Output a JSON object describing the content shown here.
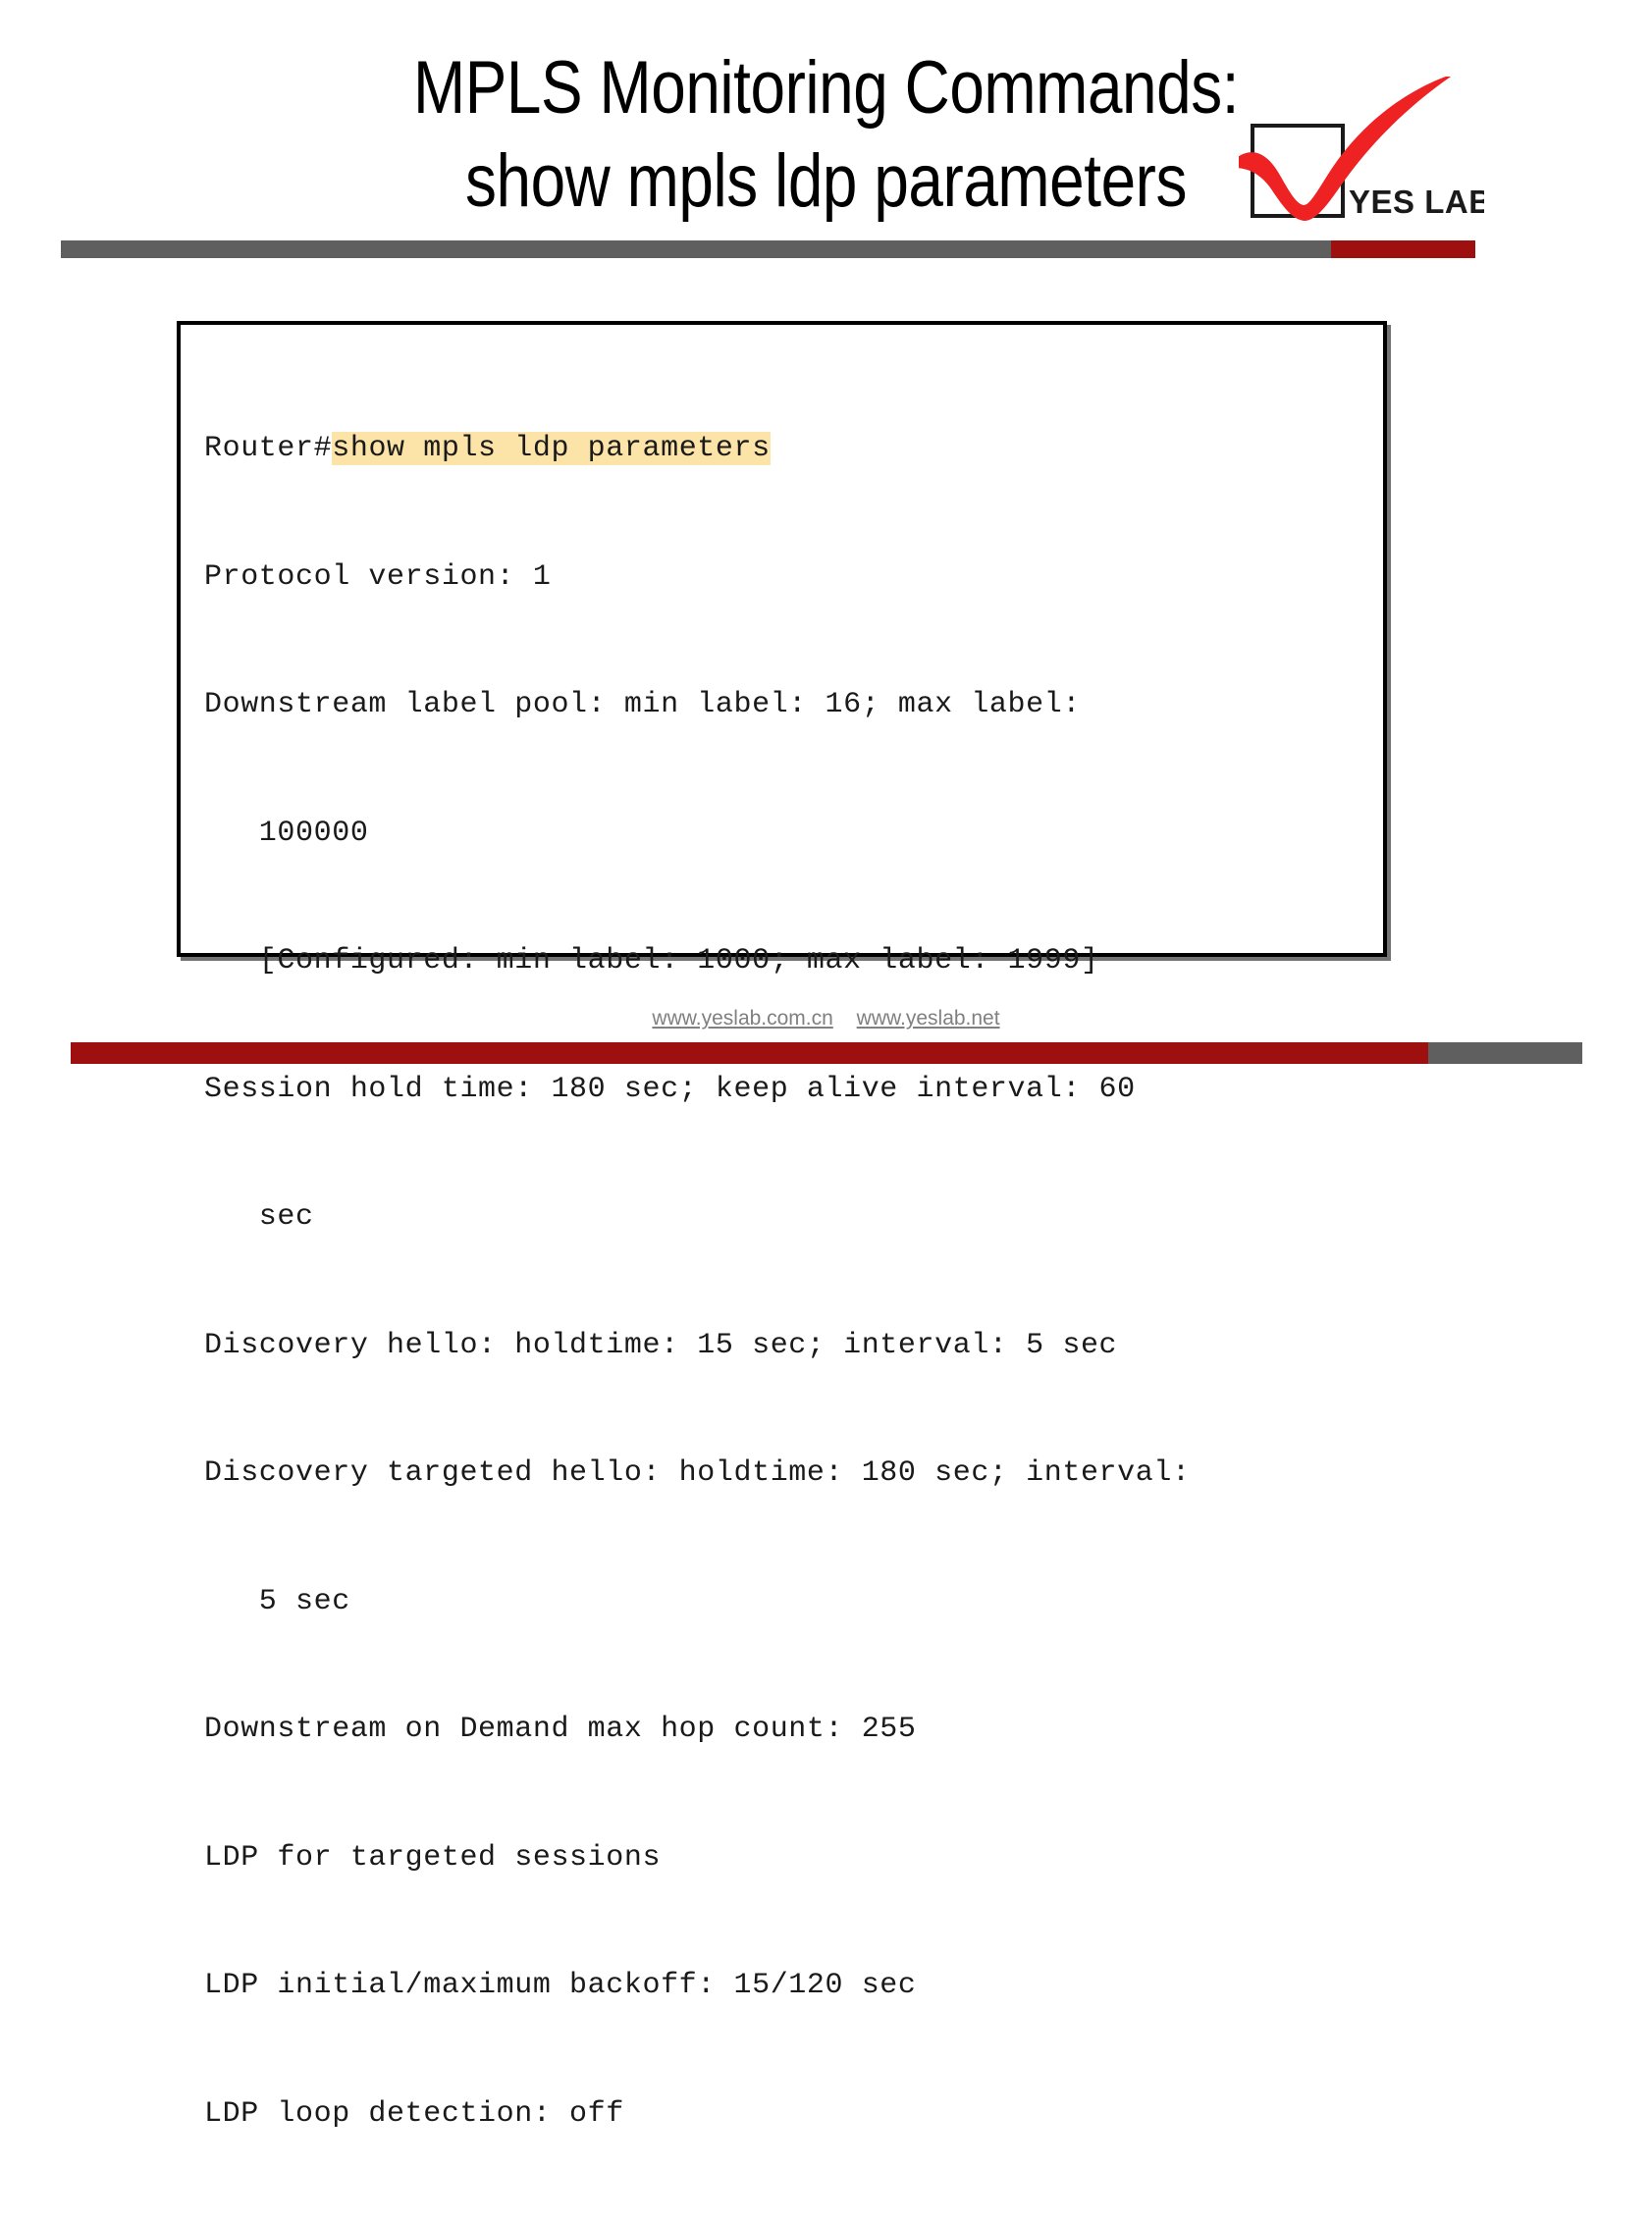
{
  "slide": {
    "title_lines": [
      "MPLS Monitoring Commands:",
      "show mpls ldp parameters"
    ]
  },
  "logo": {
    "text": "YES LAB",
    "check_color": "#ee2222",
    "box_color": "#1a1a1a"
  },
  "rules": {
    "header_gray": "#5f5f5f",
    "header_red": "#9e1010",
    "footer_red": "#9e1010",
    "footer_gray": "#5f5f5f"
  },
  "terminal": {
    "prompt": "Router#",
    "command": "show mpls ldp parameters",
    "highlight_color": "#fce3a8",
    "lines": [
      "Protocol version: 1",
      "Downstream label pool: min label: 16; max label:",
      "   100000",
      "   [Configured: min label: 1000; max label: 1999]",
      "Session hold time: 180 sec; keep alive interval: 60",
      "   sec",
      "Discovery hello: holdtime: 15 sec; interval: 5 sec",
      "Discovery targeted hello: holdtime: 180 sec; interval:",
      "   5 sec",
      "Downstream on Demand max hop count: 255",
      "LDP for targeted sessions",
      "LDP initial/maximum backoff: 15/120 sec",
      "LDP loop detection: off"
    ]
  },
  "footer": {
    "links": [
      "www.yeslab.com.cn",
      "www.yeslab.net"
    ]
  }
}
